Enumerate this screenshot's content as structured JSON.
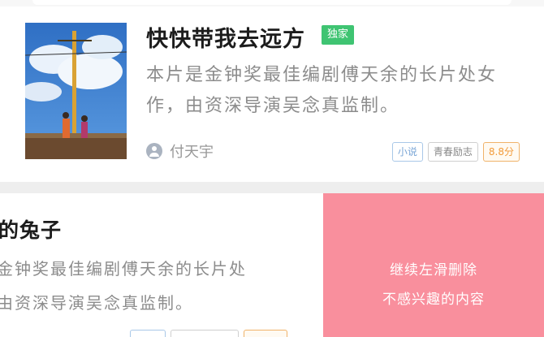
{
  "feed": {
    "item1": {
      "title": "快快带我去远方",
      "badge": "独家",
      "description": "本片是金钟奖最佳编剧傅天余的长片处女作，由资深导演吴念真监制。",
      "author": "付天宇",
      "tags": [
        "小说",
        "青春励志",
        "8.8分"
      ]
    },
    "item2": {
      "title_partial": "的兔子",
      "desc_line1": "金钟奖最佳编剧傅天余的长片处",
      "desc_line2": "由资深导演吴念真监制。"
    }
  },
  "swipe_delete": {
    "line1": "继续左滑删除",
    "line2": "不感兴趣的内容"
  },
  "colors": {
    "badge_green": "#3fc472",
    "delete_pink": "#f98f9d",
    "rating_orange": "#f29b3a"
  }
}
